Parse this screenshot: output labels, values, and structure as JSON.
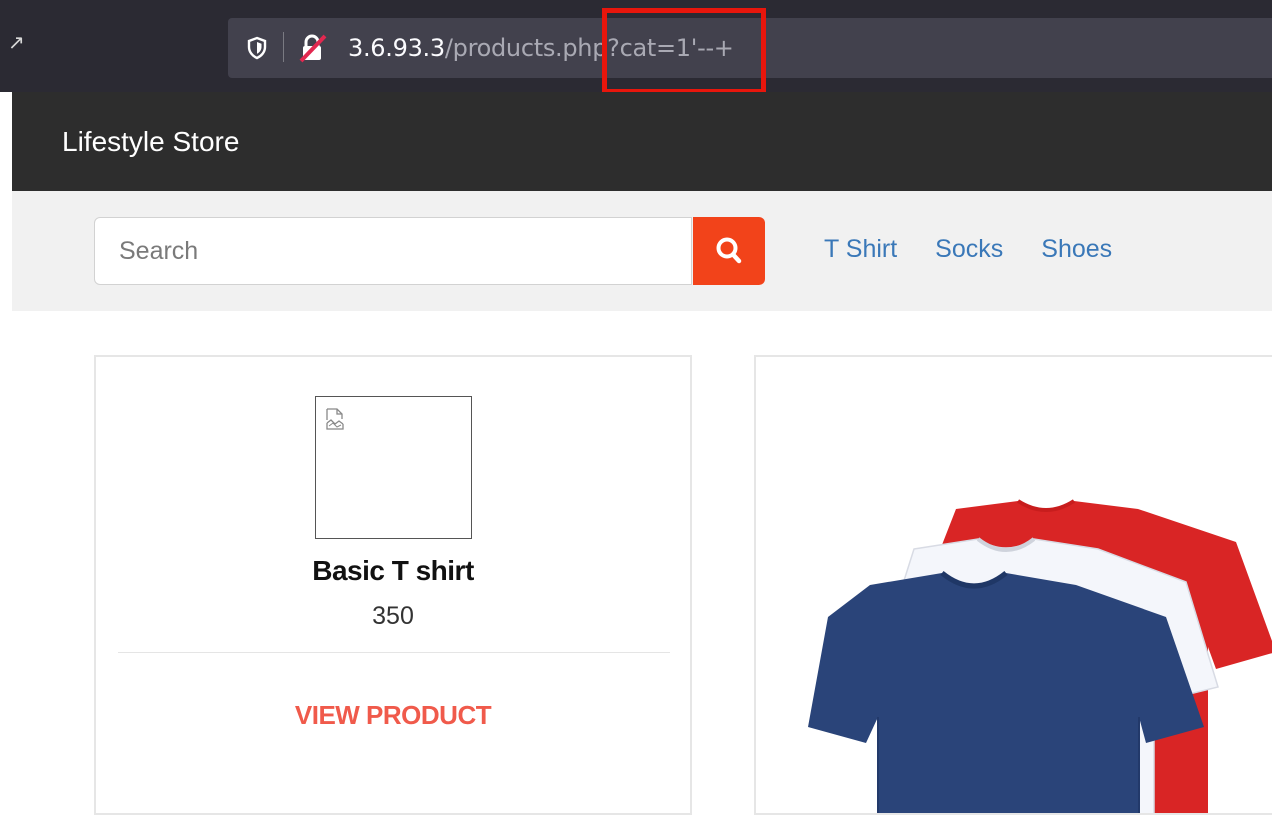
{
  "browser": {
    "url_host": "3.6.93.3",
    "url_rest": "/products.php?cat=1'--+",
    "highlight_color": "#e8160c"
  },
  "store": {
    "brand": "Lifestyle Store",
    "search_placeholder": "Search",
    "search_icon": "search-icon",
    "categories": [
      "T Shirt",
      "Socks",
      "Shoes"
    ],
    "accent_color": "#f2431a"
  },
  "products": [
    {
      "name": "Basic T shirt",
      "price": "350",
      "action": "VIEW PRODUCT",
      "image": "broken-image-icon"
    },
    {
      "image": "tshirts-image"
    }
  ]
}
